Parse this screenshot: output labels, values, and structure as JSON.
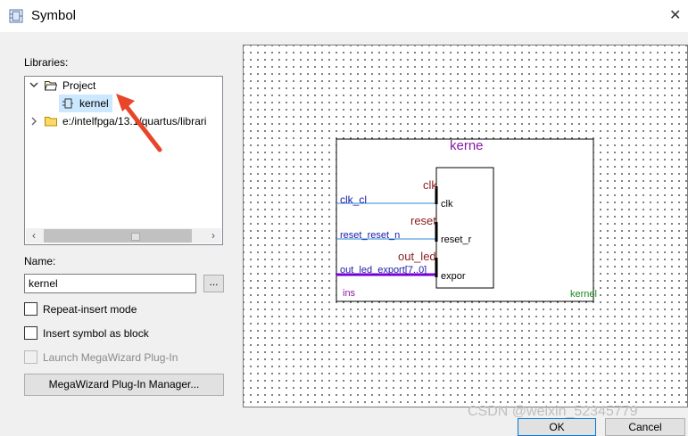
{
  "window": {
    "title": "Symbol"
  },
  "libraries": {
    "label": "Libraries:",
    "tree": [
      {
        "label": "Project",
        "expanded": true
      },
      {
        "label": "kernel",
        "selected": true
      },
      {
        "label": "e:/intelfpga/13.1/quartus/librari",
        "expanded": false
      }
    ]
  },
  "name": {
    "label": "Name:",
    "value": "kernel",
    "browse_label": "..."
  },
  "options": {
    "repeat_insert": {
      "label": "Repeat-insert mode",
      "checked": false
    },
    "insert_as_block": {
      "label": "Insert symbol as block",
      "checked": false
    },
    "launch_megawizard": {
      "label": "Launch MegaWizard Plug-In",
      "checked": false,
      "disabled": true
    }
  },
  "megawizard_button": "MegaWizard Plug-In Manager...",
  "preview": {
    "block_title": "kerne",
    "instance_label": "ins",
    "component_label": "kernel",
    "inner_signals": [
      {
        "export_name": "clk",
        "port": "clk",
        "conduit": "clk_cl"
      },
      {
        "export_name": "reset",
        "port": "reset_r",
        "conduit": "reset_reset_n"
      },
      {
        "export_name": "out_led",
        "port": "expor",
        "conduit": "out_led_export[7..0]"
      }
    ]
  },
  "buttons": {
    "ok": "OK",
    "cancel": "Cancel"
  },
  "watermark": "CSDN @weixin_52345779",
  "colors": {
    "bus": "#7b00d6",
    "wire": "#2b8ad6",
    "title": "#8a1aa8",
    "signal": "#8b1c1c",
    "export": "#1a1aa8",
    "green": "#1a8a1a",
    "selection": "#cce8ff",
    "arrow": "#e8452a"
  }
}
